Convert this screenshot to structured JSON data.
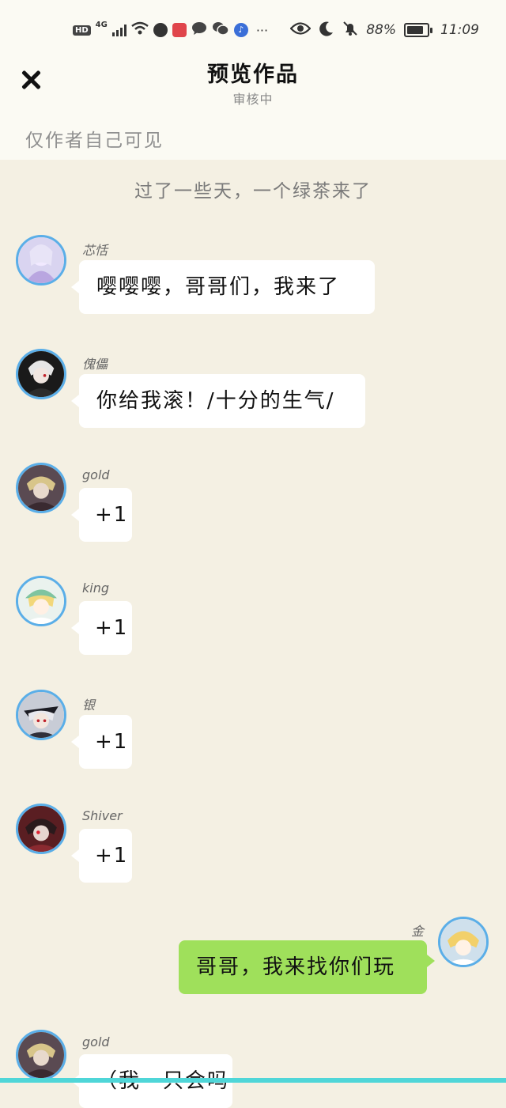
{
  "status_bar": {
    "hd": "HD",
    "network": "4G",
    "more": "···",
    "battery": "88%",
    "time": "11:09",
    "icons": [
      "signal-icon",
      "wifi-icon",
      "app-icon",
      "notes-icon",
      "chat-icon",
      "wechat-icon",
      "music-icon",
      "eye-icon",
      "moon-icon",
      "bell-off-icon",
      "battery-icon"
    ]
  },
  "header": {
    "title": "预览作品",
    "subtitle": "审核中",
    "visibility": "仅作者自己可见"
  },
  "chat": {
    "narration": "过了一些天，一个绿茶来了",
    "messages": [
      {
        "sender": "芯恬",
        "text": "嘤嘤嘤，哥哥们，我来了",
        "side": "left"
      },
      {
        "sender": "傀儡",
        "text": "你给我滚！/十分的生气/",
        "side": "left"
      },
      {
        "sender": "gold",
        "text": "+1",
        "side": "left"
      },
      {
        "sender": "king",
        "text": "+1",
        "side": "left"
      },
      {
        "sender": "银",
        "text": "+1",
        "side": "left"
      },
      {
        "sender": "Shiver",
        "text": "+1",
        "side": "left"
      },
      {
        "sender": "金",
        "text": "哥哥，我来找你们玩",
        "side": "right"
      },
      {
        "sender": "gold",
        "text": "（我一只会吗",
        "side": "left"
      }
    ]
  },
  "colors": {
    "background": "#f4f0e3",
    "header_bg": "#fbfaf3",
    "bubble_self": "#9fe05b",
    "bubble_other": "#ffffff",
    "avatar_ring": "#5aaee8"
  }
}
